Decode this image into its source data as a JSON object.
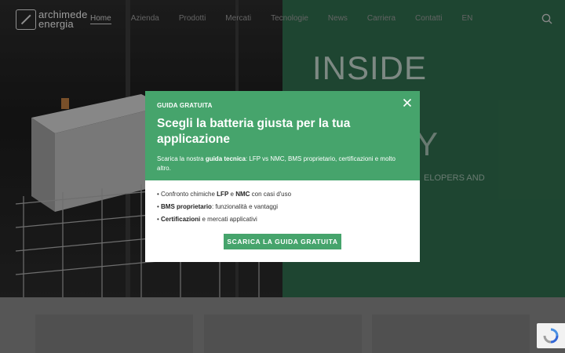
{
  "header": {
    "logo": {
      "line1": "archimede",
      "line2": "energia"
    },
    "nav": [
      {
        "label": "Home",
        "active": true
      },
      {
        "label": "Azienda"
      },
      {
        "label": "Prodotti"
      },
      {
        "label": "Mercati"
      },
      {
        "label": "Tecnologie"
      },
      {
        "label": "News"
      },
      {
        "label": "Carriera"
      },
      {
        "label": "Contatti"
      },
      {
        "label": "EN"
      }
    ],
    "search_icon": "search-icon"
  },
  "hero": {
    "title": "INSIDE",
    "title_2": "Y",
    "subtitle": "ELOPERS AND"
  },
  "modal": {
    "tag": "GUIDA GRATUITA",
    "title": "Scegli la batteria giusta per la tua applicazione",
    "desc_pre": "Scarica la nostra ",
    "desc_bold": "guida tecnica",
    "desc_post": ": LFP vs NMC, BMS proprietario, certificazioni e molto altro.",
    "bullets": [
      {
        "pre": "• Confronto chimiche ",
        "b1": "LFP",
        "mid": " e ",
        "b2": "NMC",
        "post": " con casi d'uso"
      },
      {
        "pre": "• ",
        "b1": "BMS proprietario",
        "mid": "",
        "b2": "",
        "post": ": funzionalità e vantaggi"
      },
      {
        "pre": "• ",
        "b1": "Certificazioni",
        "mid": "",
        "b2": "",
        "post": " e mercati applicativi"
      }
    ],
    "cta_label": "SCARICA LA GUIDA GRATUITA",
    "close_icon": "close-icon"
  },
  "colors": {
    "accent_green": "#46a46c",
    "hero_green": "#2f6b4c"
  }
}
